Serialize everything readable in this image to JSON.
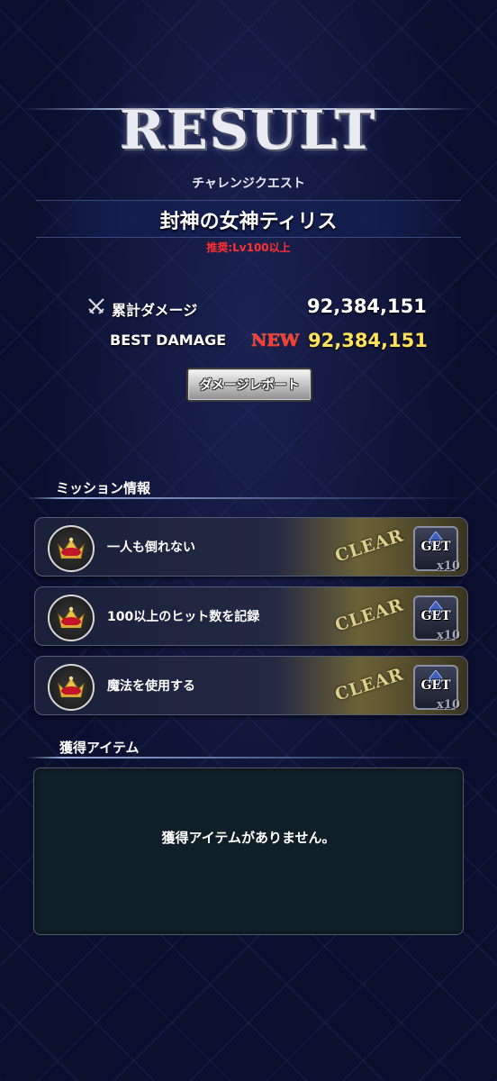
{
  "header": {
    "title": "RESULT",
    "subtitle": "チャレンジクエスト",
    "quest_name": "封神の女神ティリス",
    "recommend": "推奨:Lv100以上"
  },
  "stats": {
    "damage_label": "累計ダメージ",
    "damage_value": "92,384,151",
    "best_label": "BEST DAMAGE",
    "best_new": "NEW",
    "best_value": "92,384,151"
  },
  "report_button": "ダメージレポート",
  "missions": {
    "title": "ミッション情報",
    "items": [
      {
        "text": "一人も倒れない",
        "stamp": "CLEAR",
        "get": "GET",
        "count": "x10"
      },
      {
        "text": "100以上のヒット数を記録",
        "stamp": "CLEAR",
        "get": "GET",
        "count": "x10"
      },
      {
        "text": "魔法を使用する",
        "stamp": "CLEAR",
        "get": "GET",
        "count": "x10"
      }
    ]
  },
  "items_section": {
    "title": "獲得アイテム",
    "empty_message": "獲得アイテムがありません。"
  },
  "colors": {
    "background": "#0b0f2e",
    "recommend": "#ff3030",
    "best_value": "#ffe25a",
    "new_tag": "#ff3a2a",
    "clear_stamp": "#ddd08a"
  },
  "icons": [
    "crossed-swords-icon",
    "crown-icon",
    "crystal-icon"
  ]
}
